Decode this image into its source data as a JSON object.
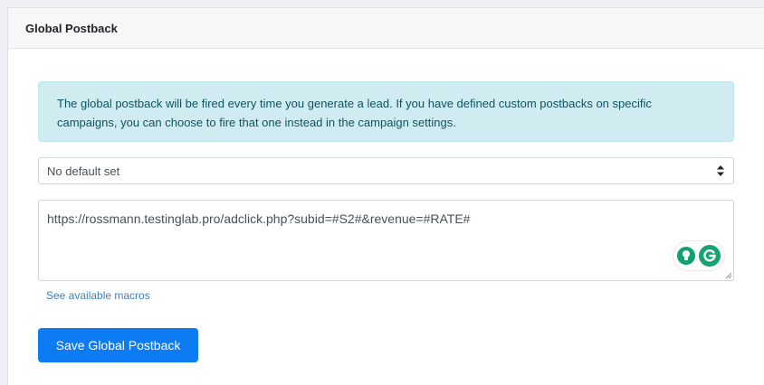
{
  "card": {
    "title": "Global Postback"
  },
  "alert": {
    "line1": "The global postback will be fired every time you generate a lead. If you have defined custom postbacks on specific",
    "line2": "campaigns, you can choose to fire that one instead in the campaign settings."
  },
  "default_select": {
    "selected": "No default set"
  },
  "postback_url": {
    "value": "https://rossmann.testinglab.pro/adclick.php?subid=#S2#&revenue=#RATE#"
  },
  "macros_link": {
    "label": "See available macros"
  },
  "save_button": {
    "label": "Save Global Postback"
  },
  "colors": {
    "primary": "#0d7bf2",
    "alert_bg": "#d1ecf1",
    "alert_text": "#0c5460",
    "grammarly": "#15a46e"
  },
  "icons": [
    "select-arrows-icon",
    "grammarly-bulb-icon",
    "grammarly-g-icon",
    "resize-handle-icon"
  ]
}
